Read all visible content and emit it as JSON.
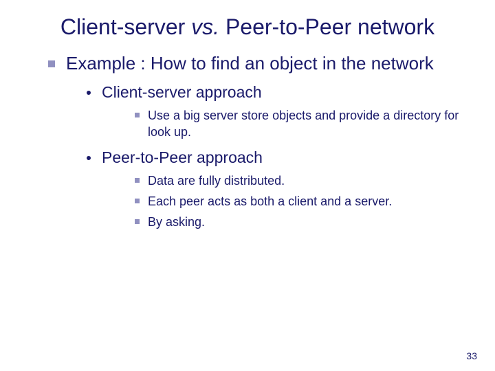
{
  "title": {
    "part1": "Client-server ",
    "italic": "vs.",
    "part2": " Peer-to-Peer network"
  },
  "main_bullet": "Example : How to find an object in the network",
  "subs": [
    {
      "label": "Client-server approach",
      "points": [
        "Use a big server store objects and provide a directory for look up."
      ]
    },
    {
      "label": "Peer-to-Peer approach",
      "points": [
        "Data are fully distributed.",
        "Each peer acts as both a client and a server.",
        "By asking."
      ]
    }
  ],
  "page_number": "33"
}
